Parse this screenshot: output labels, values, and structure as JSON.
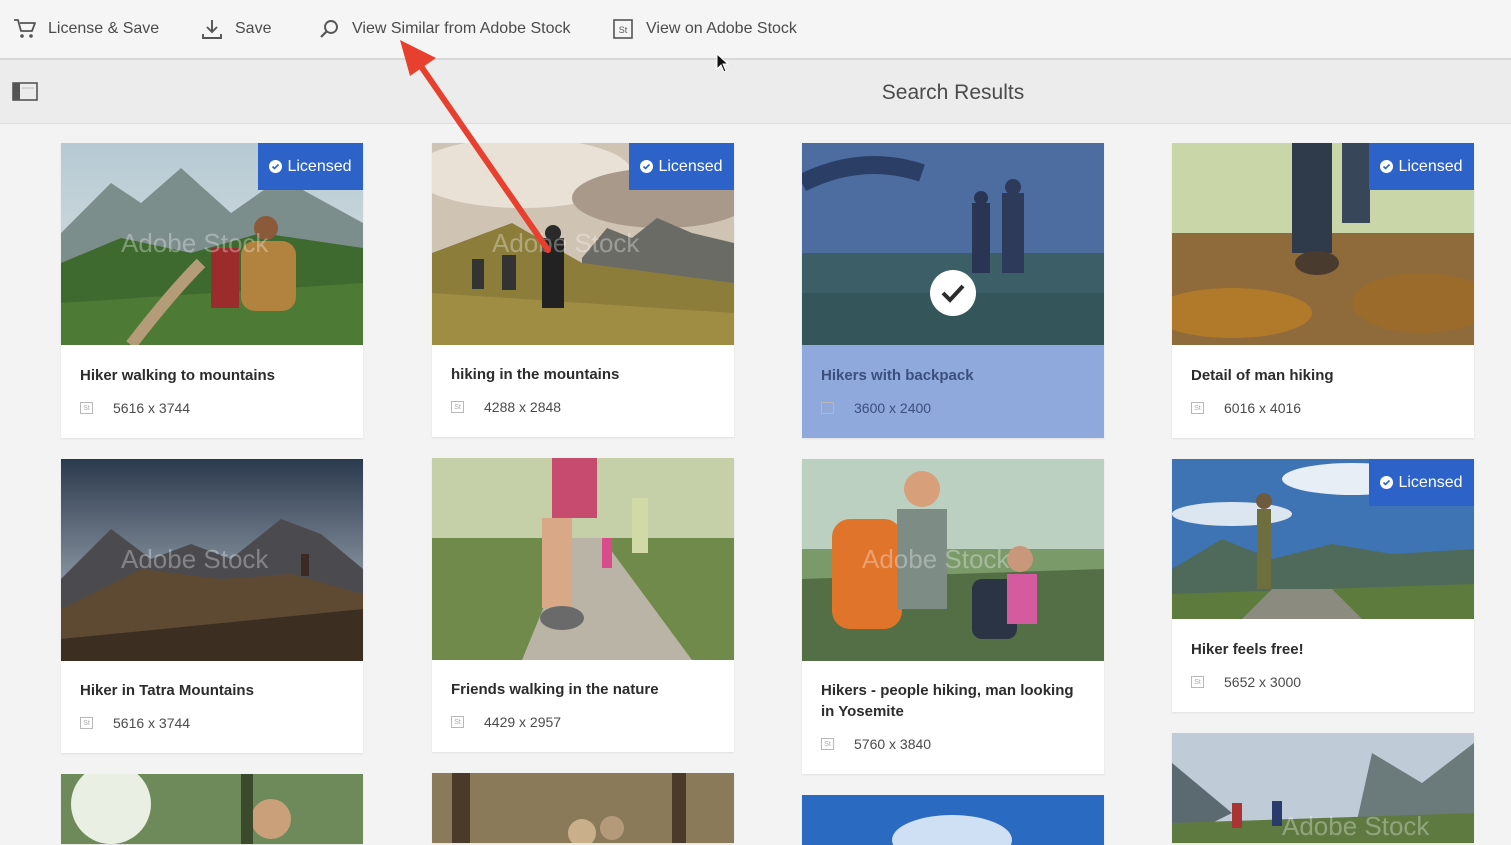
{
  "toolbar": {
    "license_save": "License & Save",
    "save": "Save",
    "view_similar": "View Similar from Adobe Stock",
    "view_on_stock": "View on Adobe Stock",
    "stock_icon_text": "St"
  },
  "header": {
    "title": "Search Results"
  },
  "badge_label": "Licensed",
  "watermark": "Adobe Stock",
  "colors": {
    "accent": "#2d63c8",
    "selected_card": "#8fa9dc",
    "annotation_arrow": "#e8402e"
  },
  "cards": [
    {
      "title": "Hiker walking to mountains",
      "dimensions": "5616 x 3744",
      "licensed": true,
      "selected": false
    },
    {
      "title": "hiking in the mountains",
      "dimensions": "4288 x 2848",
      "licensed": true,
      "selected": false
    },
    {
      "title": "Hikers with backpack",
      "dimensions": "3600 x 2400",
      "licensed": false,
      "selected": true
    },
    {
      "title": "Detail of man hiking",
      "dimensions": "6016 x 4016",
      "licensed": true,
      "selected": false
    },
    {
      "title": "Hiker in Tatra Mountains",
      "dimensions": "5616 x 3744",
      "licensed": false,
      "selected": false
    },
    {
      "title": "Friends walking in the nature",
      "dimensions": "4429 x 2957",
      "licensed": false,
      "selected": false
    },
    {
      "title": "Hikers - people hiking, man looking in Yosemite",
      "dimensions": "5760 x 3840",
      "licensed": false,
      "selected": false
    },
    {
      "title": "Hiker feels free!",
      "dimensions": "5652 x 3000",
      "licensed": true,
      "selected": false
    }
  ]
}
